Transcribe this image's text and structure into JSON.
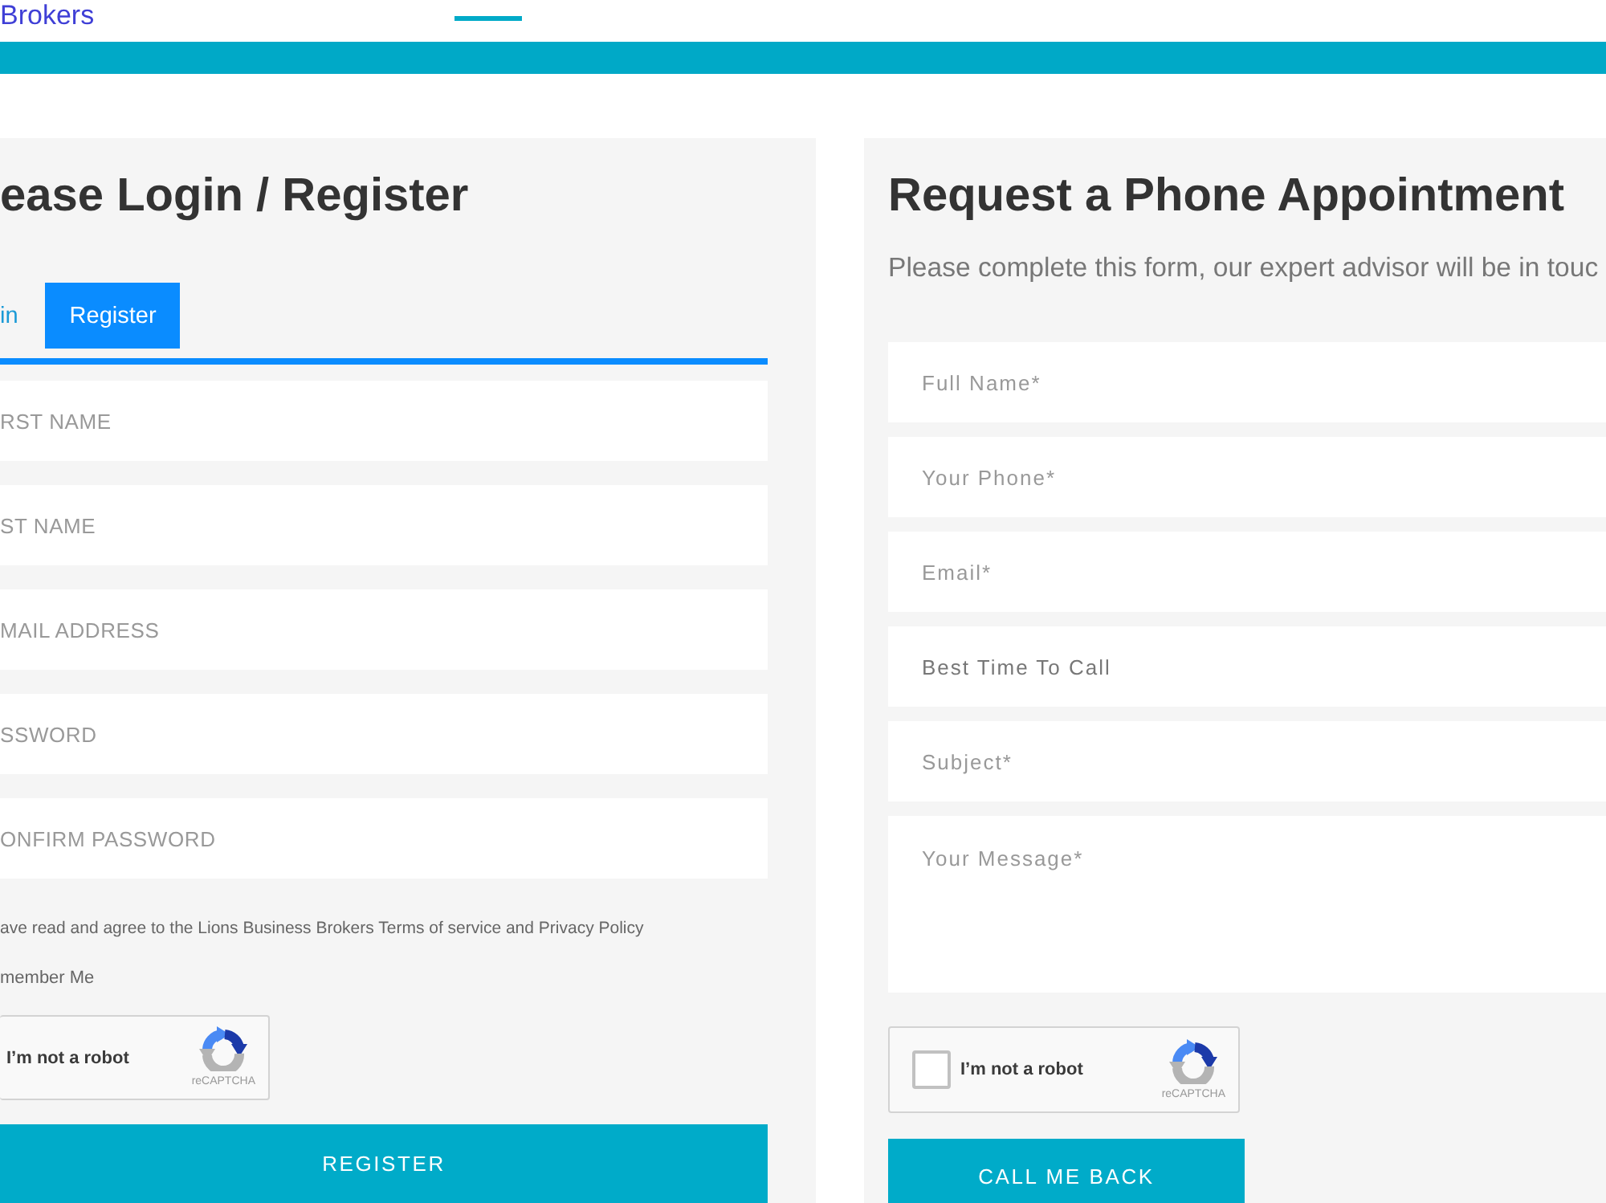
{
  "header": {
    "brand_text": "Brokers"
  },
  "login_panel": {
    "title": "ease Login / Register",
    "tabs": [
      {
        "label": "in",
        "selected": false
      },
      {
        "label": "Register",
        "selected": true
      }
    ],
    "fields": [
      {
        "placeholder": "RST NAME"
      },
      {
        "placeholder": "ST NAME"
      },
      {
        "placeholder": "MAIL ADDRESS"
      },
      {
        "placeholder": "SSWORD"
      },
      {
        "placeholder": "ONFIRM PASSWORD"
      }
    ],
    "terms_text": "ave read and agree to the Lions Business Brokers Terms of service and Privacy Policy",
    "remember_text": "member Me",
    "captcha": {
      "label": "I’m not a robot",
      "brand_text": "reCAPTCHA"
    },
    "submit_label": "REGISTER"
  },
  "appointment_panel": {
    "title": "Request a Phone Appointment",
    "subtitle": "Please complete this form, our expert advisor will be in touc",
    "fields": [
      {
        "kind": "input",
        "placeholder": "Full Name*"
      },
      {
        "kind": "input",
        "placeholder": "Your Phone*"
      },
      {
        "kind": "input",
        "placeholder": "Email*"
      },
      {
        "kind": "select",
        "value": "Best Time To Call"
      },
      {
        "kind": "input",
        "placeholder": "Subject*"
      },
      {
        "kind": "textarea",
        "placeholder": "Your Message*"
      }
    ],
    "captcha": {
      "checked": false,
      "label": "I’m not a robot",
      "brand_text": "reCAPTCHA"
    },
    "submit_label": "CALL ME BACK"
  }
}
